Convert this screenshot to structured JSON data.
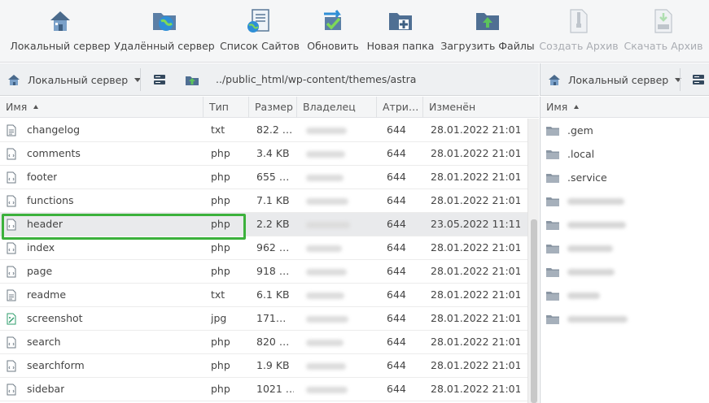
{
  "toolbar": {
    "local_server": "Локальный сервер",
    "remote_server": "Удалённый сервер",
    "site_list": "Список Сайтов",
    "refresh": "Обновить",
    "new_folder": "Новая папка",
    "upload_files": "Загрузить Файлы",
    "create_archive": "Создать Архив",
    "download_archive": "Скачать Архив"
  },
  "pathbar": {
    "left_site": "Локальный сервер",
    "path": "../public_html/wp-content/themes/astra",
    "right_site": "Локальный сервер"
  },
  "left_pane": {
    "columns": {
      "name": "Имя",
      "type": "Тип",
      "size": "Размер",
      "owner": "Владелец",
      "attrs": "Атри…",
      "modified": "Изменён"
    },
    "rows": [
      {
        "name": "changelog",
        "type": "txt",
        "size": "82.2 …",
        "attrs": "644",
        "modified": "28.01.2022 21:01…",
        "icon": "text-file-icon"
      },
      {
        "name": "comments",
        "type": "php",
        "size": "3.4 KB",
        "attrs": "644",
        "modified": "28.01.2022 21:01…",
        "icon": "php-file-icon"
      },
      {
        "name": "footer",
        "type": "php",
        "size": "655 …",
        "attrs": "644",
        "modified": "28.01.2022 21:01…",
        "icon": "php-file-icon"
      },
      {
        "name": "functions",
        "type": "php",
        "size": "7.1 KB",
        "attrs": "644",
        "modified": "28.01.2022 21:01…",
        "icon": "php-file-icon"
      },
      {
        "name": "header",
        "type": "php",
        "size": "2.2 KB",
        "attrs": "644",
        "modified": "23.05.2022 11:11…",
        "icon": "php-file-icon",
        "selected": true
      },
      {
        "name": "index",
        "type": "php",
        "size": "962 …",
        "attrs": "644",
        "modified": "28.01.2022 21:01…",
        "icon": "php-file-icon"
      },
      {
        "name": "page",
        "type": "php",
        "size": "918 …",
        "attrs": "644",
        "modified": "28.01.2022 21:01…",
        "icon": "php-file-icon"
      },
      {
        "name": "readme",
        "type": "txt",
        "size": "6.1 KB",
        "attrs": "644",
        "modified": "28.01.2022 21:01…",
        "icon": "text-file-icon"
      },
      {
        "name": "screenshot",
        "type": "jpg",
        "size": "171…",
        "attrs": "644",
        "modified": "28.01.2022 21:01…",
        "icon": "image-file-icon"
      },
      {
        "name": "search",
        "type": "php",
        "size": "820 …",
        "attrs": "644",
        "modified": "28.01.2022 21:01…",
        "icon": "php-file-icon"
      },
      {
        "name": "searchform",
        "type": "php",
        "size": "1.9 KB",
        "attrs": "644",
        "modified": "28.01.2022 21:01…",
        "icon": "php-file-icon"
      },
      {
        "name": "sidebar",
        "type": "php",
        "size": "1021 …",
        "attrs": "644",
        "modified": "28.01.2022 21:01…",
        "icon": "php-file-icon"
      }
    ]
  },
  "right_pane": {
    "column_name": "Имя",
    "items": [
      {
        "name": ".gem"
      },
      {
        "name": ".local"
      },
      {
        "name": ".service"
      }
    ]
  },
  "colors": {
    "highlight_border": "#3cb13c",
    "selected_row": "#e9eaec",
    "toolbar_bg": "#f5f6f7"
  }
}
